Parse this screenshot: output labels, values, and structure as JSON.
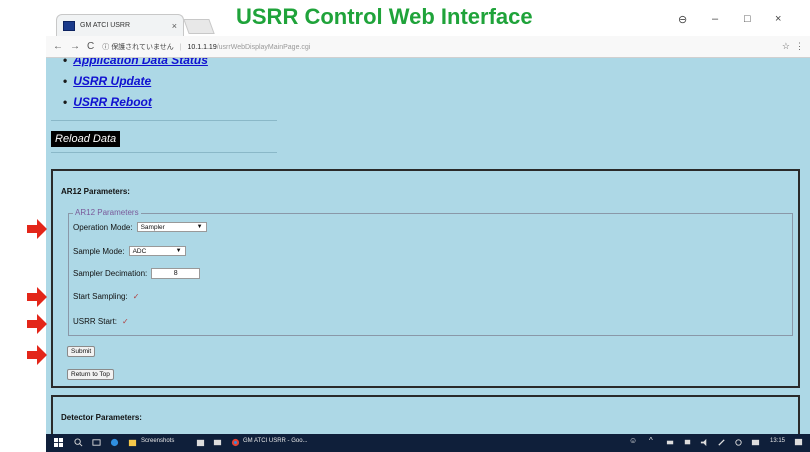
{
  "banner": {
    "title": "USRR Control Web Interface"
  },
  "browser": {
    "tab_title": "GM ATCI USRR",
    "tab_close": "×",
    "window_controls": [
      "⊖",
      "–",
      "□",
      "×"
    ],
    "nav": {
      "back": "←",
      "forward": "→",
      "reload": "C",
      "info": "ⓘ"
    },
    "security_text": "保護されていません",
    "url_host": "10.1.1.19",
    "url_path": "/usrrWebDisplayMainPage.cgi",
    "star": "☆",
    "menu": "⋮"
  },
  "page": {
    "links": [
      "Application Data Status",
      "USRR Update",
      "USRR Reboot"
    ],
    "reload_button": "Reload Data",
    "ar12": {
      "title": "AR12 Parameters:",
      "legend": "AR12 Parameters",
      "operation_mode_label": "Operation Mode:",
      "operation_mode_value": "Sampler",
      "sample_mode_label": "Sample Mode:",
      "sample_mode_value": "ADC",
      "sampler_decimation_label": "Sampler Decimation:",
      "sampler_decimation_value": "8",
      "start_sampling_label": "Start Sampling:",
      "usrr_start_label": "USRR Start:",
      "checkmark": "✓",
      "submit": "Submit",
      "return_top": "Return to Top"
    },
    "detector": {
      "title": "Detector Parameters:"
    }
  },
  "taskbar": {
    "item1": "Screenshots",
    "item2": "GM ATCI USRR - Goo...",
    "time": "13:15"
  },
  "colors": {
    "page_bg": "#add8e6",
    "banner_green": "#1fa33a",
    "link_blue": "#1010d0",
    "arrow_red": "#e32619",
    "taskbar": "#0f1f3a"
  }
}
